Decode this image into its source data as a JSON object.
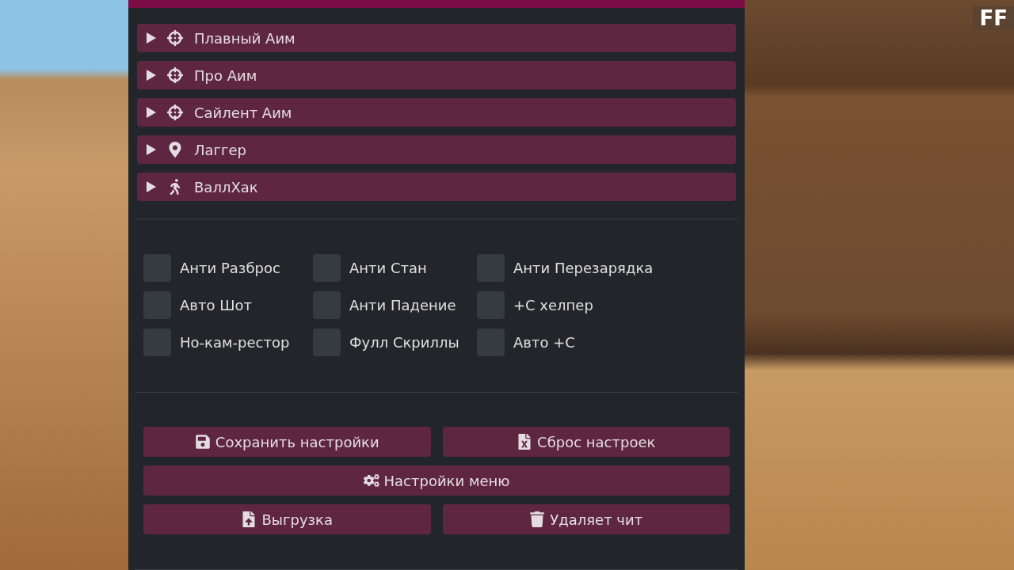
{
  "hud_text": "FF",
  "sections": [
    {
      "label": "Плавный Аим",
      "kind": "crosshair",
      "expanded": false
    },
    {
      "label": "Про Аим",
      "kind": "crosshair",
      "expanded": false
    },
    {
      "label": "Сайлент Аим",
      "kind": "crosshair",
      "expanded": false
    },
    {
      "label": "Лаггер",
      "kind": "pin",
      "expanded": false
    },
    {
      "label": "ВаллХак",
      "kind": "walker",
      "expanded": false
    }
  ],
  "options": [
    {
      "label": "Анти Разброс",
      "checked": false
    },
    {
      "label": "Анти Стан",
      "checked": false
    },
    {
      "label": "Анти Перезарядка",
      "checked": false
    },
    {
      "label": "Авто Шот",
      "checked": false
    },
    {
      "label": "Анти Падение",
      "checked": false
    },
    {
      "label": "+С хелпер",
      "checked": false
    },
    {
      "label": "Но-кам-рестор",
      "checked": false
    },
    {
      "label": "Фулл Скриллы",
      "checked": false
    },
    {
      "label": "Авто +С",
      "checked": false
    }
  ],
  "buttons": [
    {
      "label": "Сохранить настройки",
      "kind": "save",
      "wide": false
    },
    {
      "label": "Сброс настроек",
      "kind": "reset",
      "wide": false
    },
    {
      "label": "Настройки меню",
      "kind": "settings",
      "wide": true
    },
    {
      "label": "Выгрузка",
      "kind": "upload",
      "wide": false
    },
    {
      "label": "Удаляет чит",
      "kind": "delete",
      "wide": false
    }
  ]
}
